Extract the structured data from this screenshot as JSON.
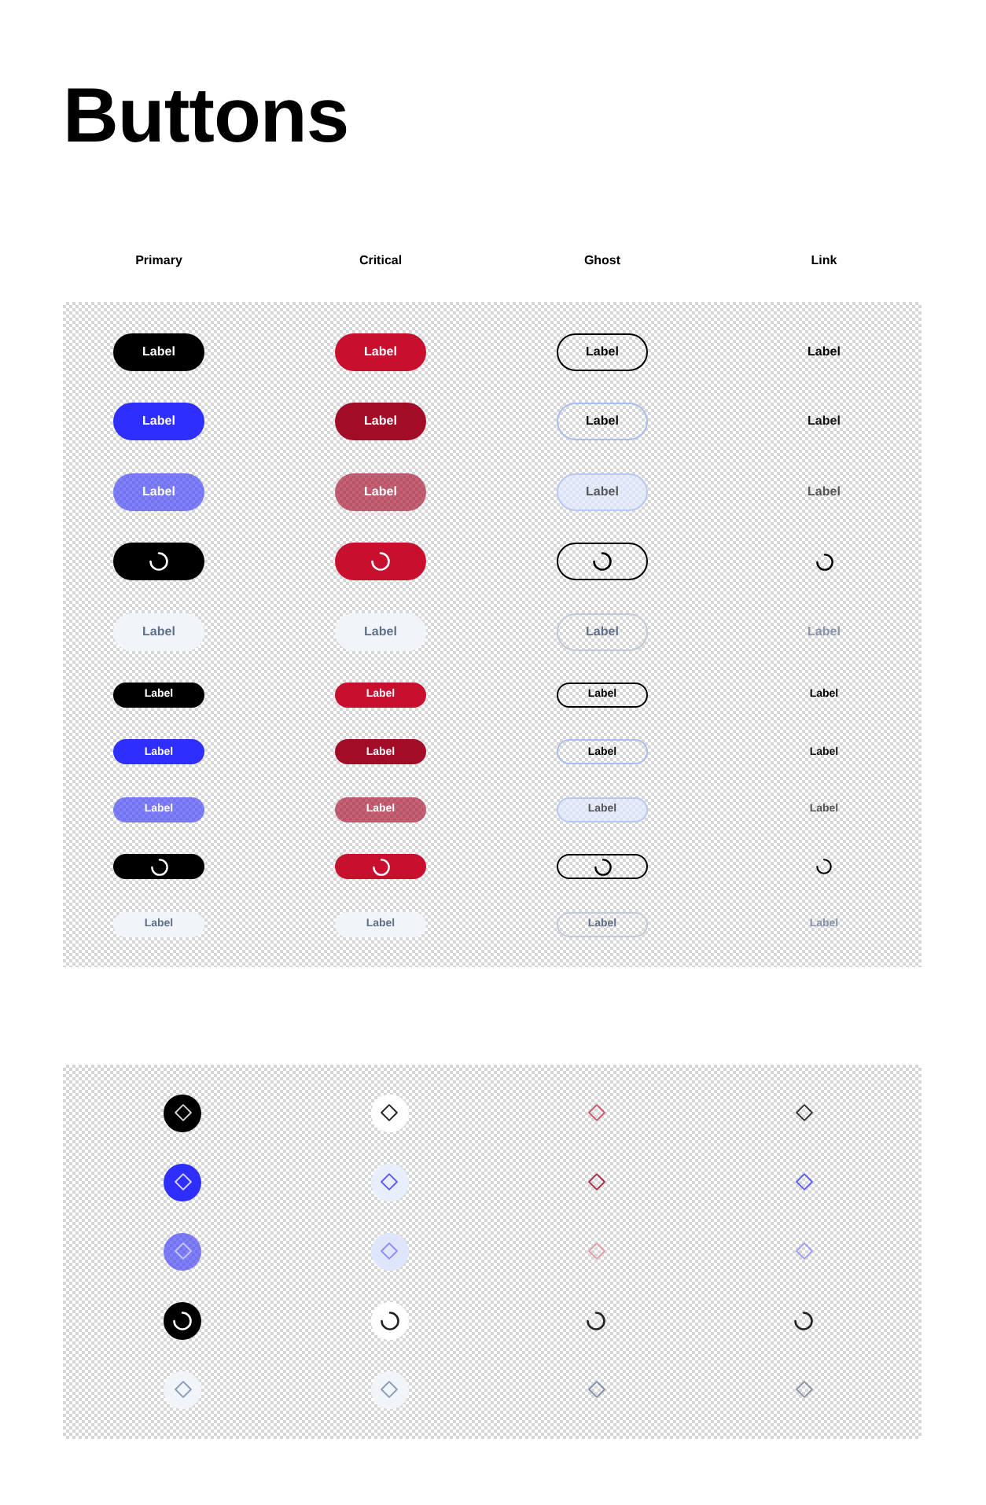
{
  "title": "Buttons",
  "columns": [
    "Primary",
    "Critical",
    "Ghost",
    "Link"
  ],
  "large_rows": [
    {
      "kind": "default",
      "labels": [
        "Label",
        "Label",
        "Label",
        "Label"
      ]
    },
    {
      "kind": "hover",
      "labels": [
        "Label",
        "Label",
        "Label",
        "Label"
      ]
    },
    {
      "kind": "pressed",
      "labels": [
        "Label",
        "Label",
        "Label",
        "Label"
      ]
    },
    {
      "kind": "loading"
    },
    {
      "kind": "disabled",
      "labels": [
        "Label",
        "Label",
        "Label",
        "Label"
      ]
    }
  ],
  "small_rows": [
    {
      "kind": "default",
      "labels": [
        "Label",
        "Label",
        "Label",
        "Label"
      ]
    },
    {
      "kind": "hover",
      "labels": [
        "Label",
        "Label",
        "Label",
        "Label"
      ]
    },
    {
      "kind": "pressed",
      "labels": [
        "Label",
        "Label",
        "Label",
        "Label"
      ]
    },
    {
      "kind": "loading"
    },
    {
      "kind": "disabled",
      "labels": [
        "Label",
        "Label",
        "Label",
        "Label"
      ]
    }
  ],
  "icon_rows": [
    {
      "kind": "default"
    },
    {
      "kind": "hover"
    },
    {
      "kind": "pressed"
    },
    {
      "kind": "loading"
    },
    {
      "kind": "disabled"
    }
  ]
}
